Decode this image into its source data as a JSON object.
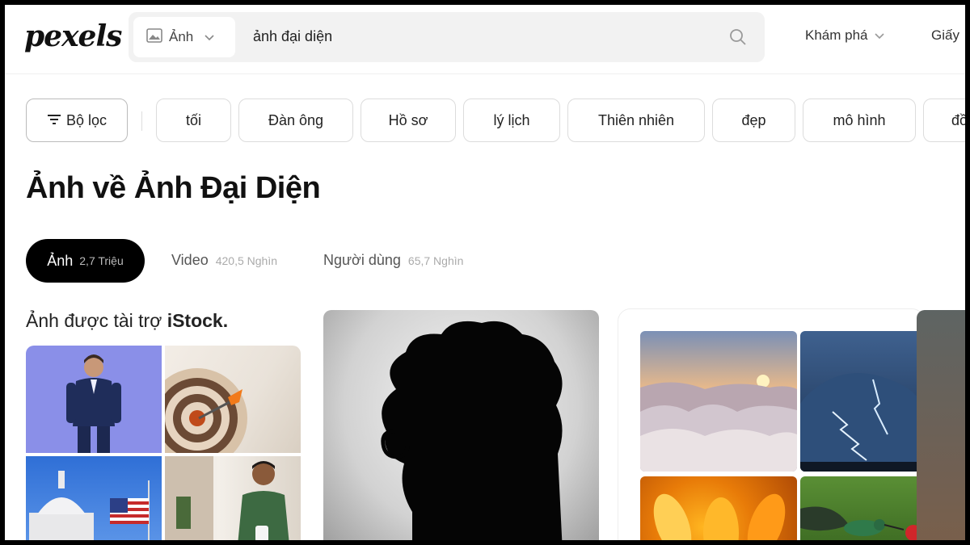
{
  "header": {
    "logo": "pexels",
    "search": {
      "type_label": "Ảnh",
      "query": "ảnh đại diện"
    },
    "nav": {
      "explore": "Khám phá",
      "license": "Giấy"
    }
  },
  "filters": {
    "filter_button": "Bộ lọc",
    "chips": [
      "tối",
      "Đàn ông",
      "Hồ sơ",
      "lý lịch",
      "Thiên nhiên",
      "đẹp",
      "mô hình",
      "đồ"
    ]
  },
  "page_title": "Ảnh về Ảnh Đại Diện",
  "tabs": [
    {
      "label": "Ảnh",
      "count": "2,7 Triệu",
      "active": true
    },
    {
      "label": "Video",
      "count": "420,5 Nghìn",
      "active": false
    },
    {
      "label": "Người dùng",
      "count": "65,7 Nghìn",
      "active": false
    }
  ],
  "sponsored": {
    "prefix": "Ảnh được tài trợ",
    "brand": "iStock."
  },
  "colors": {
    "active_tab_bg": "#000000",
    "search_bg": "#f2f2f2",
    "chip_border": "#dcdcdc"
  }
}
